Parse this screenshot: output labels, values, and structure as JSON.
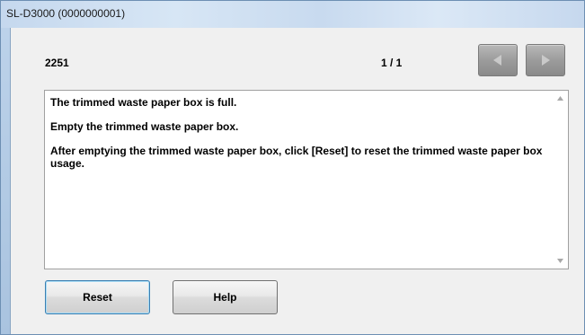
{
  "window": {
    "title": "SL-D3000 (0000000001)"
  },
  "header": {
    "code": "2251",
    "page_indicator": "1 / 1",
    "prev_icon": "triangle-left-icon",
    "next_icon": "triangle-right-icon"
  },
  "message": {
    "lines": [
      "The trimmed waste paper box is full.",
      "Empty the trimmed waste paper box.",
      "After emptying  the trimmed waste paper box, click [Reset] to reset the trimmed waste paper box usage."
    ]
  },
  "buttons": {
    "reset_label": "Reset",
    "help_label": "Help"
  },
  "colors": {
    "nav_button": "#9c9c9c",
    "reset_focus_border": "#3c7fb1"
  }
}
